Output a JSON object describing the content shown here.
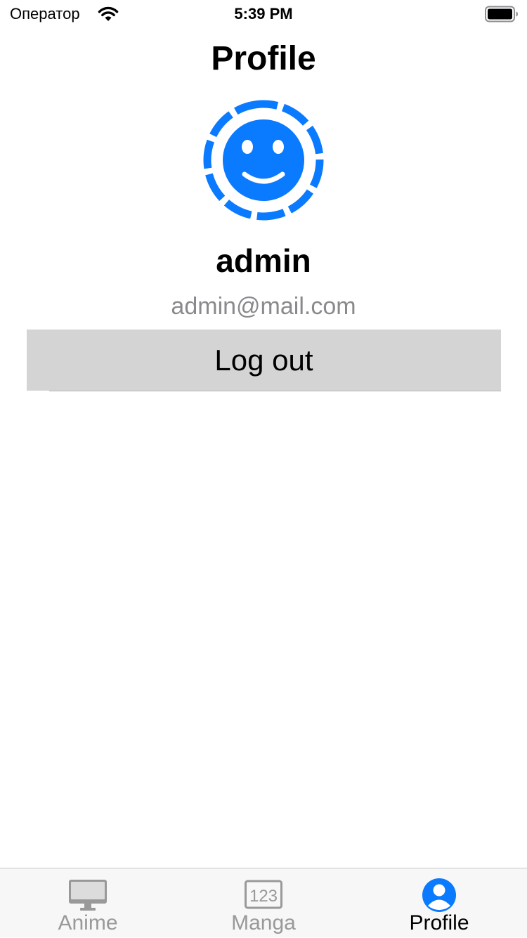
{
  "status_bar": {
    "carrier": "Оператор",
    "time": "5:39 PM",
    "wifi_icon": "wifi-icon",
    "battery_icon": "battery-icon"
  },
  "header": {
    "title": "Profile"
  },
  "profile": {
    "avatar_icon": "smiley-face-icon",
    "username": "admin",
    "email": "admin@mail.com",
    "logout_label": "Log out"
  },
  "tab_bar": {
    "items": [
      {
        "label": "Anime",
        "icon": "desktop-computer-icon",
        "active": false
      },
      {
        "label": "Manga",
        "icon": "number-123-icon",
        "active": false
      },
      {
        "label": "Profile",
        "icon": "person-circle-icon",
        "active": true
      }
    ]
  },
  "colors": {
    "accent": "#0a7aff",
    "inactive_tab": "#999999",
    "secondary_text": "#8a8a8e",
    "button_background": "#d4d4d4",
    "tab_bar_background": "#f7f7f7"
  }
}
